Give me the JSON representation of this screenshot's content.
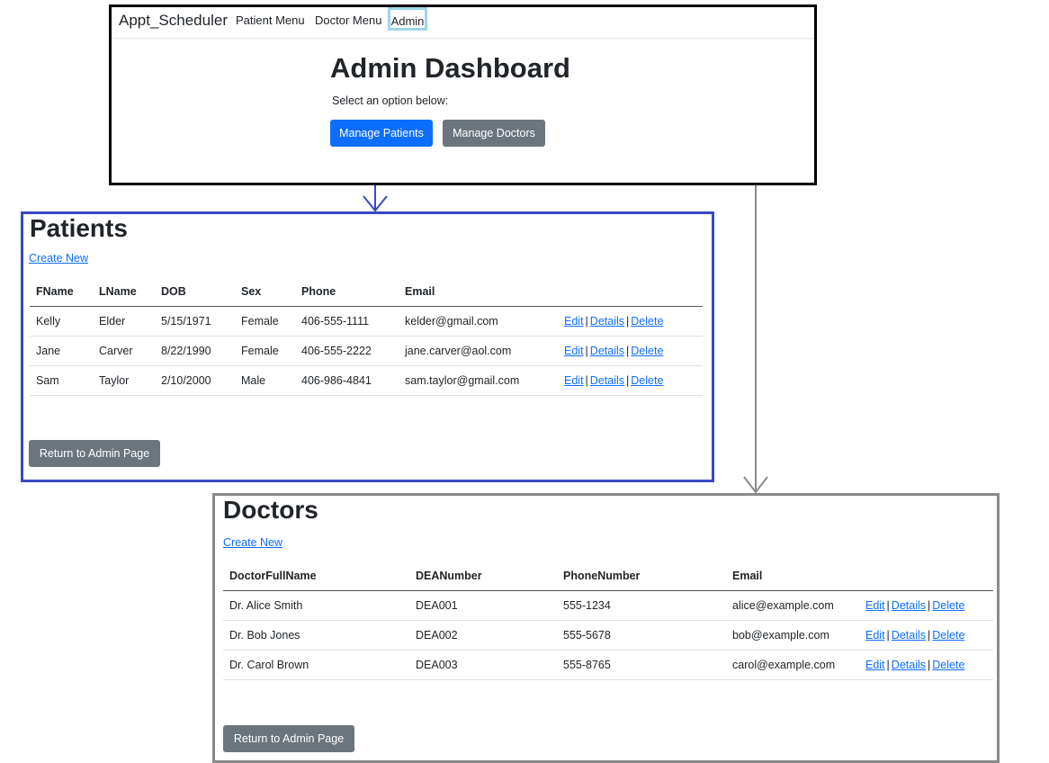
{
  "navbar": {
    "brand": "Appt_Scheduler",
    "items": [
      "Patient Menu",
      "Doctor Menu",
      "Admin"
    ]
  },
  "dashboard": {
    "title": "Admin Dashboard",
    "subtitle": "Select an option below:",
    "manage_patients_label": "Manage Patients",
    "manage_doctors_label": "Manage Doctors"
  },
  "patients": {
    "title": "Patients",
    "create_new": "Create New",
    "headers": [
      "FName",
      "LName",
      "DOB",
      "Sex",
      "Phone",
      "Email"
    ],
    "rows": [
      [
        "Kelly",
        "Elder",
        "5/15/1971",
        "Female",
        "406-555-1111",
        "kelder@gmail.com"
      ],
      [
        "Jane",
        "Carver",
        "8/22/1990",
        "Female",
        "406-555-2222",
        "jane.carver@aol.com"
      ],
      [
        "Sam",
        "Taylor",
        "2/10/2000",
        "Male",
        "406-986-4841",
        "sam.taylor@gmail.com"
      ]
    ],
    "actions": [
      "Edit",
      "Details",
      "Delete"
    ],
    "return_label": "Return to Admin Page"
  },
  "doctors": {
    "title": "Doctors",
    "create_new": "Create New",
    "headers": [
      "DoctorFullName",
      "DEANumber",
      "PhoneNumber",
      "Email"
    ],
    "rows": [
      [
        "Dr. Alice Smith",
        "DEA001",
        "555-1234",
        "alice@example.com"
      ],
      [
        "Dr. Bob Jones",
        "DEA002",
        "555-5678",
        "bob@example.com"
      ],
      [
        "Dr. Carol Brown",
        "DEA003",
        "555-8765",
        "carol@example.com"
      ]
    ],
    "actions": [
      "Edit",
      "Details",
      "Delete"
    ],
    "return_label": "Return to Admin Page"
  },
  "colors": {
    "admin_highlight": "#9ed6e3",
    "patients_border": "#3b48c4",
    "doctors_border": "#8a8a8a",
    "primary": "#0d6efd",
    "secondary": "#6c757d"
  }
}
